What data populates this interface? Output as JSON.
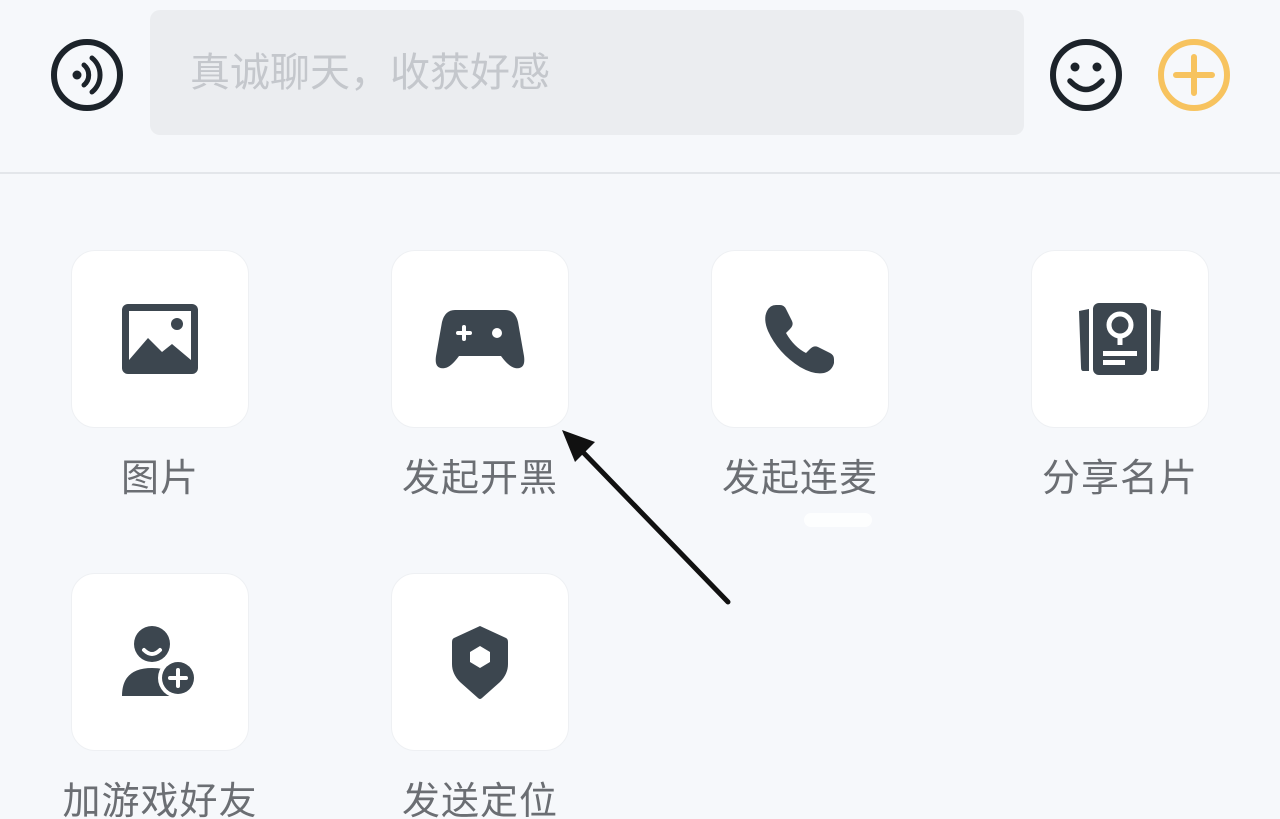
{
  "input_bar": {
    "placeholder": "真诚聊天，收获好感",
    "left_icon": "voice-icon",
    "emoji_icon": "smiley-icon",
    "plus_icon": "plus-circle-icon",
    "accent_color": "#f7c35f"
  },
  "actions": [
    {
      "label": "图片",
      "icon": "image-icon"
    },
    {
      "label": "发起开黑",
      "icon": "gamepad-icon"
    },
    {
      "label": "发起连麦",
      "icon": "phone-icon"
    },
    {
      "label": "分享名片",
      "icon": "namecard-icon"
    },
    {
      "label": "加游戏好友",
      "icon": "add-friend-icon"
    },
    {
      "label": "发送定位",
      "icon": "location-shield-icon"
    }
  ],
  "colors": {
    "background": "#f6f8fb",
    "icon": "#3c464f",
    "label": "#6b6e73"
  }
}
